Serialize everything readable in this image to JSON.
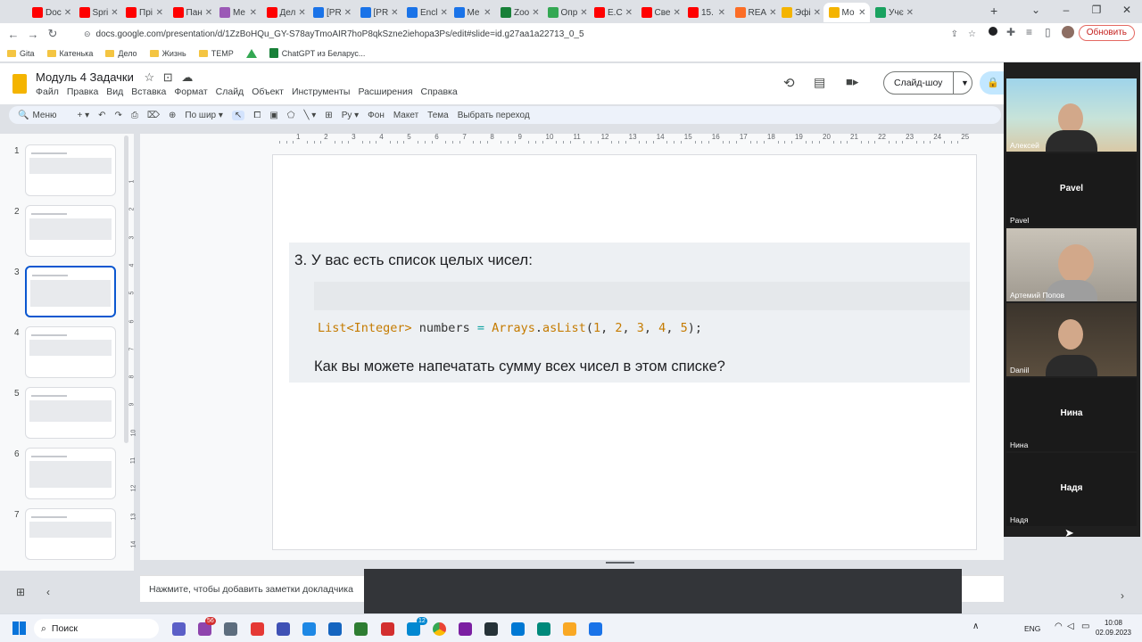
{
  "browser": {
    "tabs": [
      {
        "label": "Doc",
        "color": "#ff0000"
      },
      {
        "label": "Spri",
        "color": "#ff0000"
      },
      {
        "label": "Прі",
        "color": "#ff0000"
      },
      {
        "label": "Пан",
        "color": "#ff0000"
      },
      {
        "label": "Me",
        "color": "#9b59b6"
      },
      {
        "label": "Дел",
        "color": "#ff0000"
      },
      {
        "label": "[PR",
        "color": "#1a73e8"
      },
      {
        "label": "[PR",
        "color": "#1a73e8"
      },
      {
        "label": "Encl",
        "color": "#1a73e8"
      },
      {
        "label": "Me",
        "color": "#1a73e8"
      },
      {
        "label": "Zoo",
        "color": "#188038"
      },
      {
        "label": "Опр",
        "color": "#34a853"
      },
      {
        "label": "E.C",
        "color": "#ff0000"
      },
      {
        "label": "Све",
        "color": "#ff0000"
      },
      {
        "label": "15.",
        "color": "#ff0000"
      },
      {
        "label": "REA",
        "color": "#fc6d26"
      },
      {
        "label": "Эфі",
        "color": "#f4b400"
      },
      {
        "label": "Мо",
        "color": "#f4b400",
        "active": true
      },
      {
        "label": "Учє",
        "color": "#1aa260"
      }
    ],
    "url": "docs.google.com/presentation/d/1ZzBoHQu_GY-S78ayTmoAIR7hoP8qkSzne2iehopa3Ps/edit#slide=id.g27aa1a22713_0_5",
    "update_label": "Обновить",
    "bookmarks": [
      {
        "label": "Gita",
        "icon": "folder"
      },
      {
        "label": "Катенька",
        "icon": "folder"
      },
      {
        "label": "Дело",
        "icon": "folder"
      },
      {
        "label": "Жизнь",
        "icon": "folder"
      },
      {
        "label": "TEMP",
        "icon": "folder"
      },
      {
        "label": "",
        "icon": "drive-icon"
      },
      {
        "label": "ChatGPT из Беларус...",
        "icon": "sheet-icon"
      }
    ]
  },
  "docs": {
    "title": "Модуль 4 Задачки",
    "menu": [
      "Файл",
      "Правка",
      "Вид",
      "Вставка",
      "Формат",
      "Слайд",
      "Объект",
      "Инструменты",
      "Расширения",
      "Справка"
    ],
    "slideshow_label": "Слайд-шоу",
    "toolbar": {
      "menu_label": "Меню",
      "zoom_label": "По шир",
      "background_label": "Фон",
      "layout_label": "Макет",
      "theme_label": "Тема",
      "transition_label": "Выбрать переход"
    },
    "ruler_top": [
      "1",
      "2",
      "3",
      "4",
      "5",
      "6",
      "7",
      "8",
      "9",
      "10",
      "11",
      "12",
      "13",
      "14",
      "15",
      "16",
      "17",
      "18",
      "19",
      "20",
      "21",
      "22",
      "23",
      "24",
      "25"
    ],
    "ruler_left": [
      "1",
      "2",
      "3",
      "4",
      "5",
      "6",
      "7",
      "8",
      "9",
      "10",
      "11",
      "12",
      "13",
      "14"
    ],
    "slides": [
      {
        "number": "1"
      },
      {
        "number": "2"
      },
      {
        "number": "3",
        "selected": true
      },
      {
        "number": "4"
      },
      {
        "number": "5"
      },
      {
        "number": "6"
      },
      {
        "number": "7"
      }
    ],
    "current_slide": {
      "heading": "3. У вас есть список целых чисел:",
      "code": [
        {
          "text": "List<Integer>",
          "color": "#c57b00"
        },
        {
          "text": " numbers ",
          "color": "#333333"
        },
        {
          "text": "=",
          "color": "#0fa3a3"
        },
        {
          "text": " ",
          "color": "#333333"
        },
        {
          "text": "Arrays",
          "color": "#c57b00"
        },
        {
          "text": ".",
          "color": "#333333"
        },
        {
          "text": "asList",
          "color": "#c57b00"
        },
        {
          "text": "(",
          "color": "#333333"
        },
        {
          "text": "1",
          "color": "#c57b00"
        },
        {
          "text": ", ",
          "color": "#333333"
        },
        {
          "text": "2",
          "color": "#c57b00"
        },
        {
          "text": ", ",
          "color": "#333333"
        },
        {
          "text": "3",
          "color": "#c57b00"
        },
        {
          "text": ", ",
          "color": "#333333"
        },
        {
          "text": "4",
          "color": "#c57b00"
        },
        {
          "text": ", ",
          "color": "#333333"
        },
        {
          "text": "5",
          "color": "#c57b00"
        },
        {
          "text": ");",
          "color": "#333333"
        }
      ],
      "question": "Как вы можете напечатать сумму всех чисел в этом списке?"
    },
    "notes_placeholder": "Нажмите, чтобы добавить заметки докладчика"
  },
  "zoom": {
    "participants": [
      {
        "name": "Алексей",
        "video": true
      },
      {
        "name": "Pavel",
        "video": false
      },
      {
        "name": "Артемий Попов",
        "video": true
      },
      {
        "name": "Daniil",
        "video": true
      },
      {
        "name": "Нина",
        "video": false
      },
      {
        "name": "Надя",
        "video": false
      }
    ]
  },
  "taskbar": {
    "search_label": "Поиск",
    "language": "ENG",
    "time": "10:08",
    "date": "02.09.2023",
    "badges": [
      "56",
      "12"
    ]
  }
}
